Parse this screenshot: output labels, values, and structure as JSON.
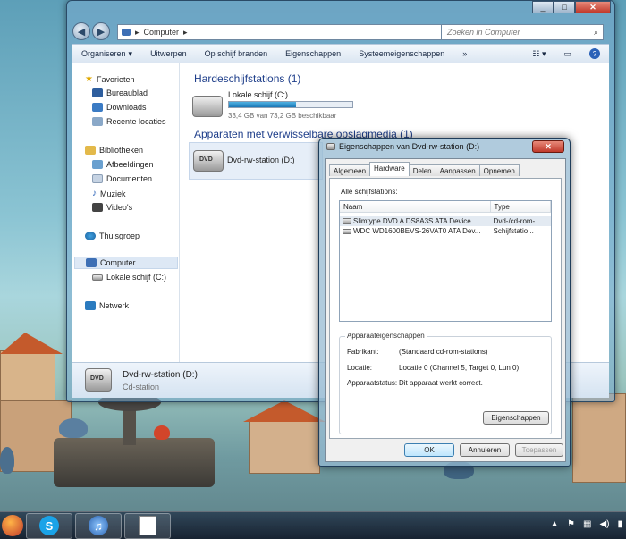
{
  "explorer": {
    "address": {
      "path": "Computer"
    },
    "search": {
      "placeholder": "Zoeken in Computer"
    },
    "toolbar": [
      "Organiseren",
      "Uitwerpen",
      "Op schijf branden",
      "Eigenschappen",
      "Systeemeigenschappen",
      "»"
    ],
    "nav": {
      "favorites": "Favorieten",
      "fav_items": [
        "Bureaublad",
        "Downloads",
        "Recente locaties"
      ],
      "libraries": "Bibliotheken",
      "lib_items": [
        "Afbeeldingen",
        "Documenten",
        "Muziek",
        "Video's"
      ],
      "homegroup": "Thuisgroep",
      "computer": "Computer",
      "computer_items": [
        "Lokale schijf (C:)"
      ],
      "network": "Netwerk"
    },
    "groups": {
      "hdd_title": "Hardeschijfstations (1)",
      "removable_title": "Apparaten met verwisselbare opslagmedia (1)"
    },
    "drives": {
      "c_name": "Lokale schijf (C:)",
      "c_free": "33,4 GB van 73,2 GB beschikbaar",
      "c_used_fraction": 0.54,
      "dvd_name": "Dvd-rw-station (D:)"
    },
    "details": {
      "name": "Dvd-rw-station (D:)",
      "type": "Cd-station"
    }
  },
  "dialog": {
    "title": "Eigenschappen van Dvd-rw-station (D:)",
    "tabs": [
      "Algemeen",
      "Hardware",
      "Delen",
      "Aanpassen",
      "Opnemen"
    ],
    "active_tab": "Hardware",
    "all_drives_label": "Alle schijfstations:",
    "columns": [
      "Naam",
      "Type"
    ],
    "rows": [
      {
        "name": "Slimtype DVD A  DS8A3S ATA Device",
        "type": "Dvd-/cd-rom-..."
      },
      {
        "name": "WDC WD1600BEVS-26VAT0 ATA Dev...",
        "type": "Schijfstatio..."
      }
    ],
    "props_legend": "Apparaateigenschappen",
    "props": {
      "manufacturer_label": "Fabrikant:",
      "manufacturer": "(Standaard cd-rom-stations)",
      "location_label": "Locatie:",
      "location": "Locatie 0 (Channel 5, Target 0, Lun 0)",
      "status_label": "Apparaatstatus:",
      "status": "Dit apparaat werkt correct."
    },
    "properties_button": "Eigenschappen",
    "ok": "OK",
    "cancel": "Annuleren",
    "apply": "Toepassen"
  }
}
